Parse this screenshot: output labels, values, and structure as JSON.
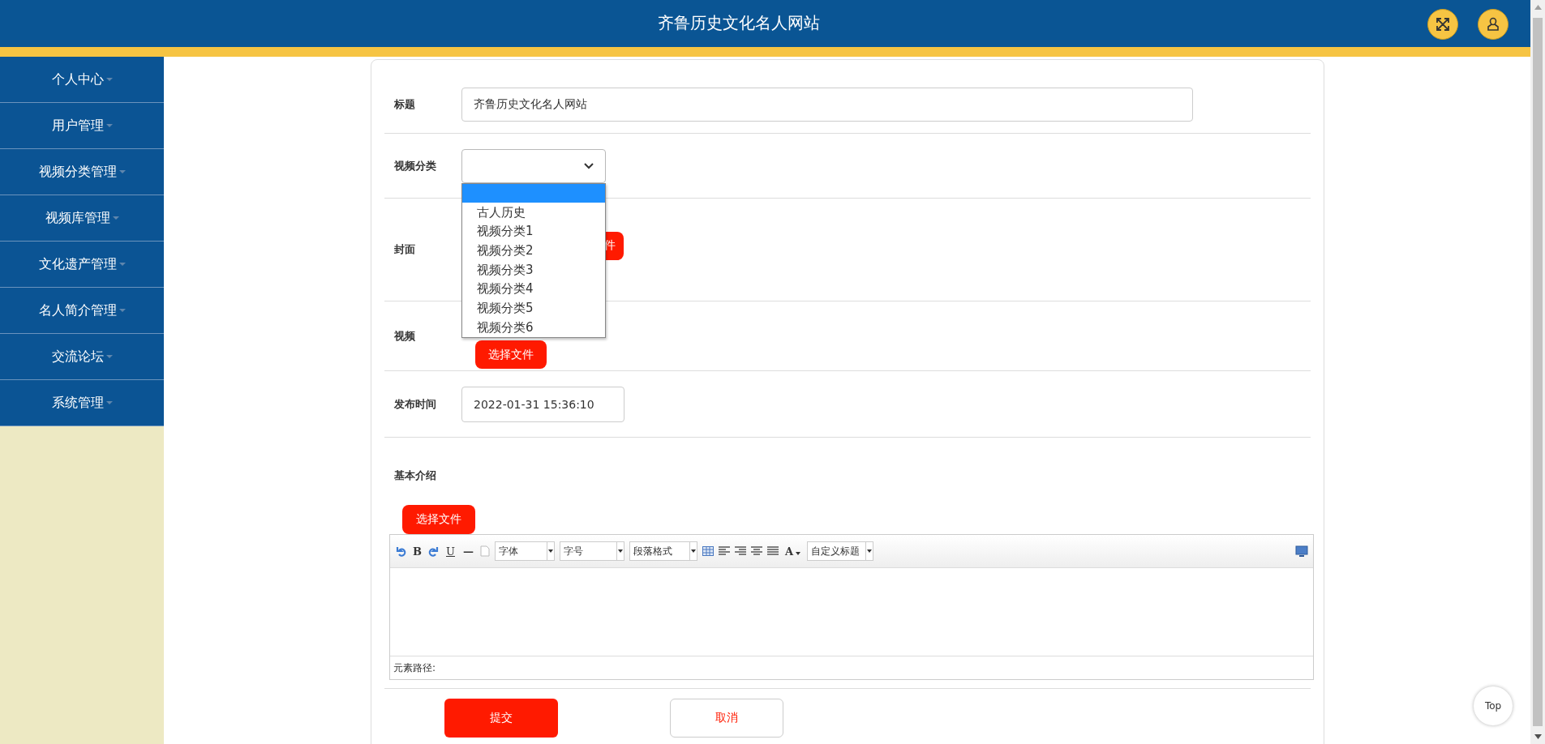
{
  "header": {
    "title": "齐鲁历史文化名人网站"
  },
  "sidebar": {
    "items": [
      {
        "label": "个人中心"
      },
      {
        "label": "用户管理"
      },
      {
        "label": "视频分类管理"
      },
      {
        "label": "视频库管理"
      },
      {
        "label": "文化遗产管理"
      },
      {
        "label": "名人简介管理"
      },
      {
        "label": "交流论坛"
      },
      {
        "label": "系统管理"
      }
    ]
  },
  "form": {
    "title": {
      "label": "标题",
      "value": "齐鲁历史文化名人网站"
    },
    "category": {
      "label": "视频分类",
      "expanded": true,
      "options": [
        {
          "selected": true
        },
        {
          "label": "古人历史",
          "selected": false
        },
        {
          "label": "视频分类1",
          "selected": false
        },
        {
          "label": "视频分类2",
          "selected": false
        },
        {
          "label": "视频分类3",
          "selected": false
        },
        {
          "label": "视频分类4",
          "selected": false
        },
        {
          "label": "视频分类5",
          "selected": false
        },
        {
          "label": "视频分类6",
          "selected": false
        }
      ]
    },
    "cover": {
      "label": "封面",
      "button": "件"
    },
    "video": {
      "label": "视频",
      "button": "选择文件"
    },
    "publish_time": {
      "label": "发布时间",
      "value": "2022-01-31 15:36:10"
    },
    "intro": {
      "label": "基本介绍",
      "button": "选择文件",
      "editor": {
        "toolbar": [
          {
            "kind": "undo"
          },
          {
            "kind": "text",
            "label": "B"
          },
          {
            "kind": "redo"
          },
          {
            "kind": "underline",
            "label": "U"
          },
          {
            "kind": "text",
            "label": "—"
          },
          {
            "kind": "page"
          },
          {
            "kind": "select",
            "label": "字体"
          },
          {
            "kind": "select",
            "label": "字号"
          },
          {
            "kind": "select",
            "label": "段落格式"
          },
          {
            "kind": "table"
          },
          {
            "kind": "left"
          },
          {
            "kind": "right"
          },
          {
            "kind": "center"
          },
          {
            "kind": "justify"
          },
          {
            "kind": "color",
            "label": "A"
          },
          {
            "kind": "select",
            "label": "自定义标题"
          },
          {
            "kind": "preview"
          }
        ],
        "status": "元素路径:"
      }
    },
    "actions": [
      {
        "label": "提交",
        "kind": "primary"
      },
      {
        "label": "取消",
        "kind": "secondary"
      }
    ]
  },
  "top_button": "Top"
}
